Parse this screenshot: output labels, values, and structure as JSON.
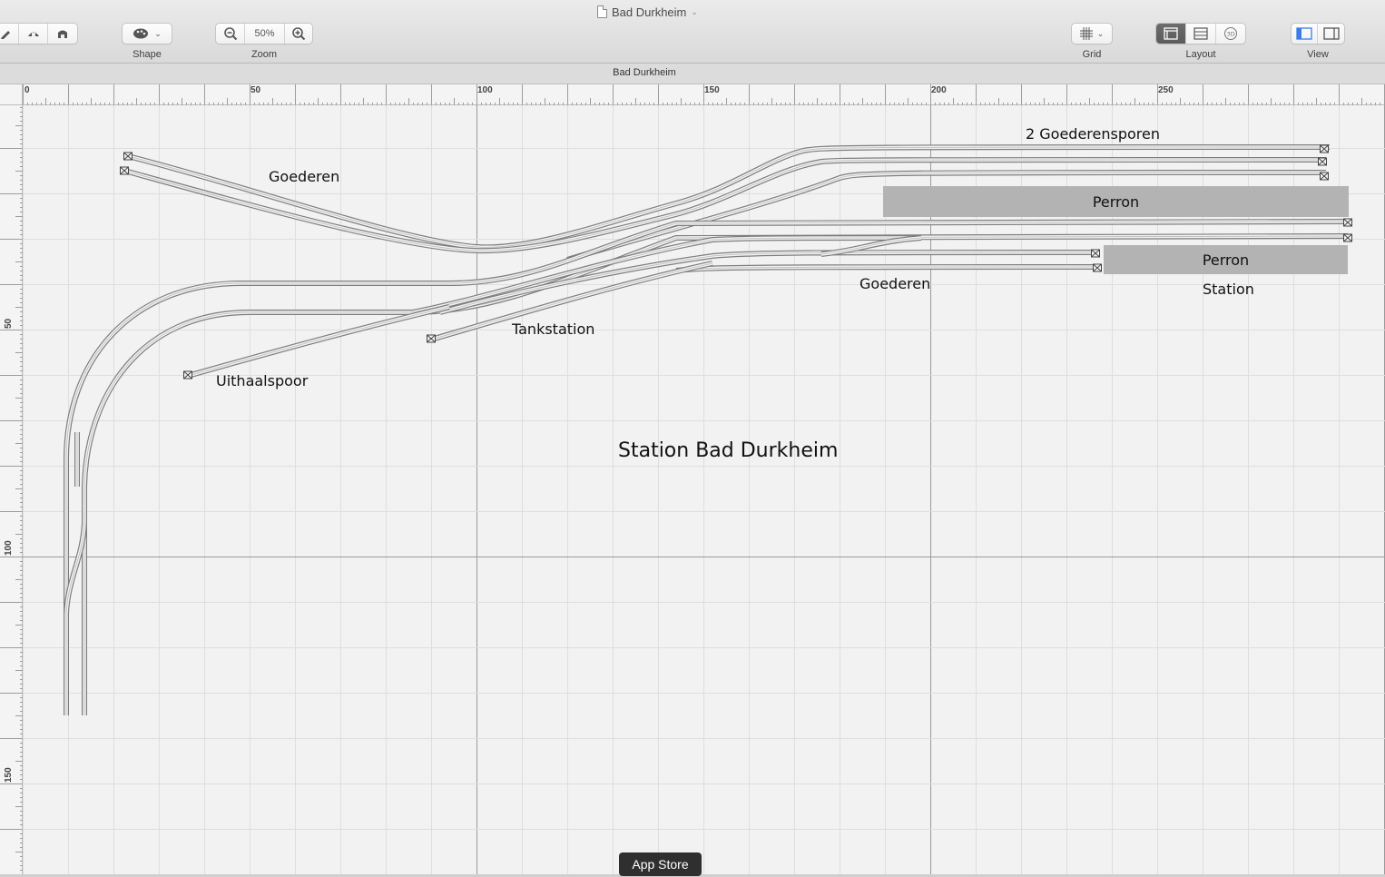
{
  "window": {
    "title": "Bad Durkheim"
  },
  "toolbar": {
    "shape": {
      "label": "Shape"
    },
    "zoom": {
      "label": "Zoom",
      "value": "50%"
    },
    "grid": {
      "label": "Grid"
    },
    "layout": {
      "label": "Layout",
      "options": [
        "plan",
        "list",
        "3D"
      ],
      "selected": "plan"
    },
    "view": {
      "label": "View"
    }
  },
  "tab": {
    "title": "Bad Durkheim"
  },
  "rulers": {
    "horizontal": [
      "0",
      "50",
      "100",
      "150",
      "200",
      "250"
    ],
    "vertical": [
      "50",
      "100",
      "150"
    ]
  },
  "canvas": {
    "title": "Station Bad Durkheim",
    "labels": {
      "goederen_top": "Goederen",
      "goederensporen": "2 Goederensporen",
      "goederen_mid": "Goederen",
      "tankstation": "Tankstation",
      "uithaalspoor": "Uithaalspoor",
      "station": "Station"
    },
    "platforms": {
      "upper": "Perron",
      "lower": "Perron"
    }
  },
  "dock": {
    "tooltip": "App Store"
  },
  "colors": {
    "platform": "#b3b3b3",
    "track": "#7d7d7d",
    "grid": "#dedede",
    "grid_major": "#9a9a9a"
  }
}
